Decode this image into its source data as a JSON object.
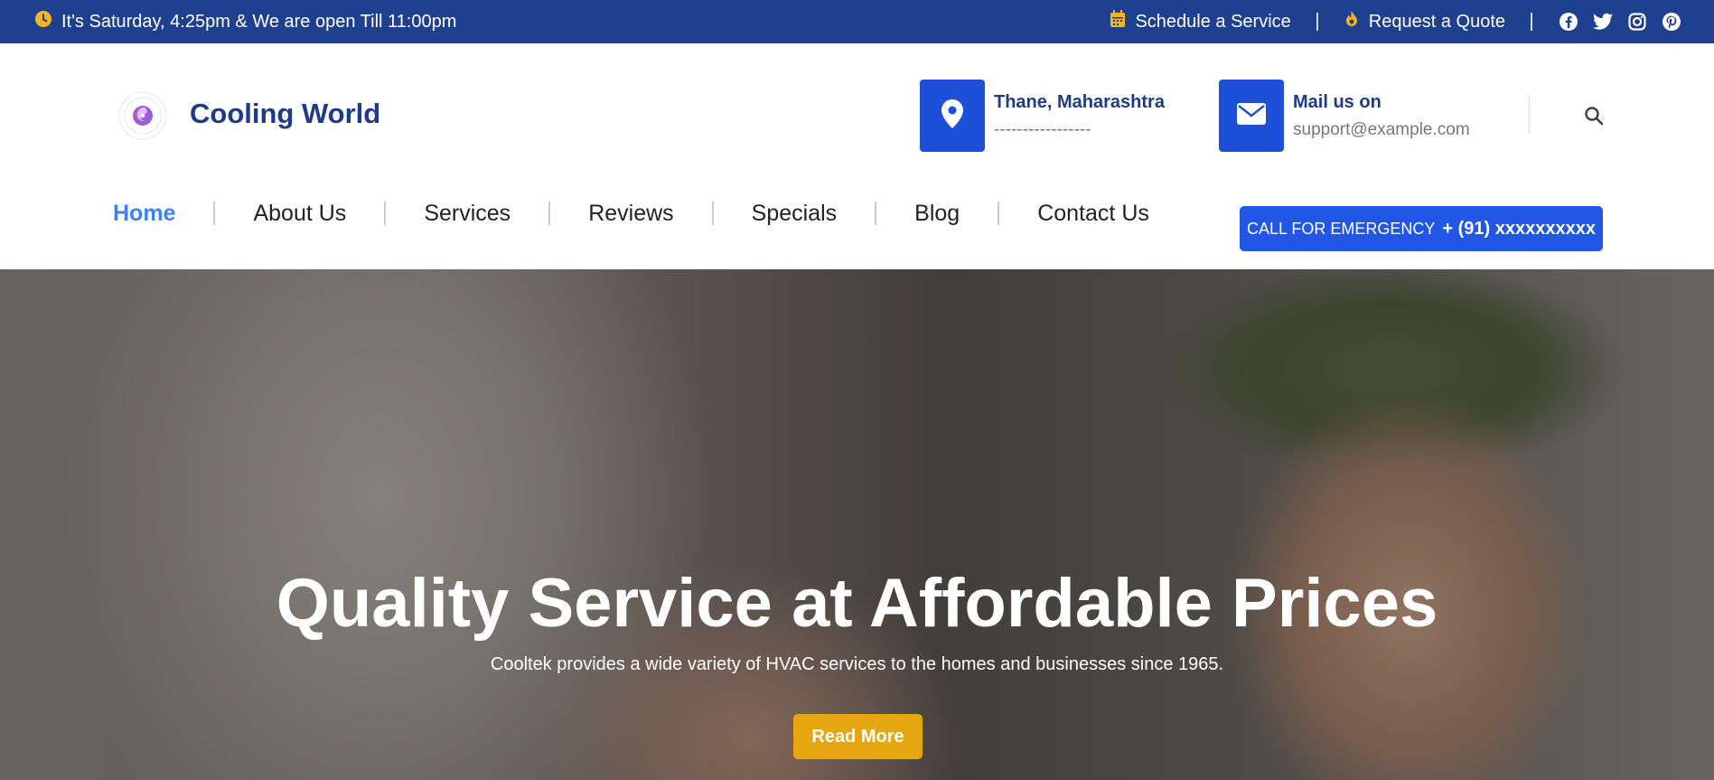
{
  "topbar": {
    "hours_text": "It's Saturday, 4:25pm & We are open Till 11:00pm",
    "schedule_label": "Schedule a Service",
    "quote_label": "Request a Quote",
    "socials": [
      "facebook-icon",
      "twitter-icon",
      "instagram-icon",
      "pinterest-icon"
    ],
    "icon_color": "#f5b521",
    "bg_color": "#1f3f8f"
  },
  "header": {
    "brand": "Cooling World",
    "location": {
      "title": "Thane, Maharashtra",
      "detail": "-----------------"
    },
    "mail": {
      "title": "Mail us on",
      "detail": "support@example.com"
    }
  },
  "nav": {
    "items": [
      {
        "label": "Home",
        "active": true
      },
      {
        "label": "About Us"
      },
      {
        "label": "Services"
      },
      {
        "label": "Reviews"
      },
      {
        "label": "Specials"
      },
      {
        "label": "Blog"
      },
      {
        "label": "Contact Us"
      }
    ],
    "emergency_label": "CALL FOR EMERGENCY",
    "emergency_phone": "+ (91) xxxxxxxxxx"
  },
  "hero": {
    "title": "Quality Service at Affordable Prices",
    "subtitle": "Cooltek provides a wide variety of HVAC services to the homes and businesses since 1965.",
    "button_label": "Read More"
  },
  "colors": {
    "primary": "#1d4fd8",
    "navy": "#1e3a8a",
    "accent": "#e6a60f",
    "active_link": "#3b82f6"
  }
}
